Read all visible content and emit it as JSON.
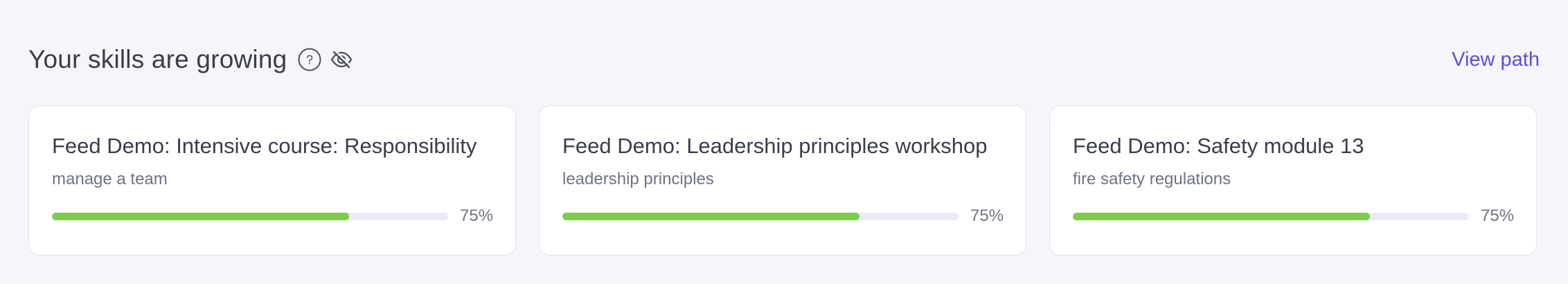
{
  "header": {
    "title": "Your skills are growing",
    "help_icon": "question-circle-icon",
    "visibility_icon": "eye-off-icon",
    "view_path_label": "View path"
  },
  "colors": {
    "accent": "#5751d8",
    "progress": "#7ecb50",
    "track": "#ebebf3",
    "background": "#f6f6fa"
  },
  "cards": [
    {
      "title": "Feed Demo: Intensive course: Responsibility",
      "skill": "manage a team",
      "progress": 0.75,
      "progress_label": "75%"
    },
    {
      "title": "Feed Demo: Leadership principles workshop",
      "skill": "leadership principles",
      "progress": 0.75,
      "progress_label": "75%"
    },
    {
      "title": "Feed Demo: Safety module 13",
      "skill": "fire safety regulations",
      "progress": 0.75,
      "progress_label": "75%"
    }
  ]
}
